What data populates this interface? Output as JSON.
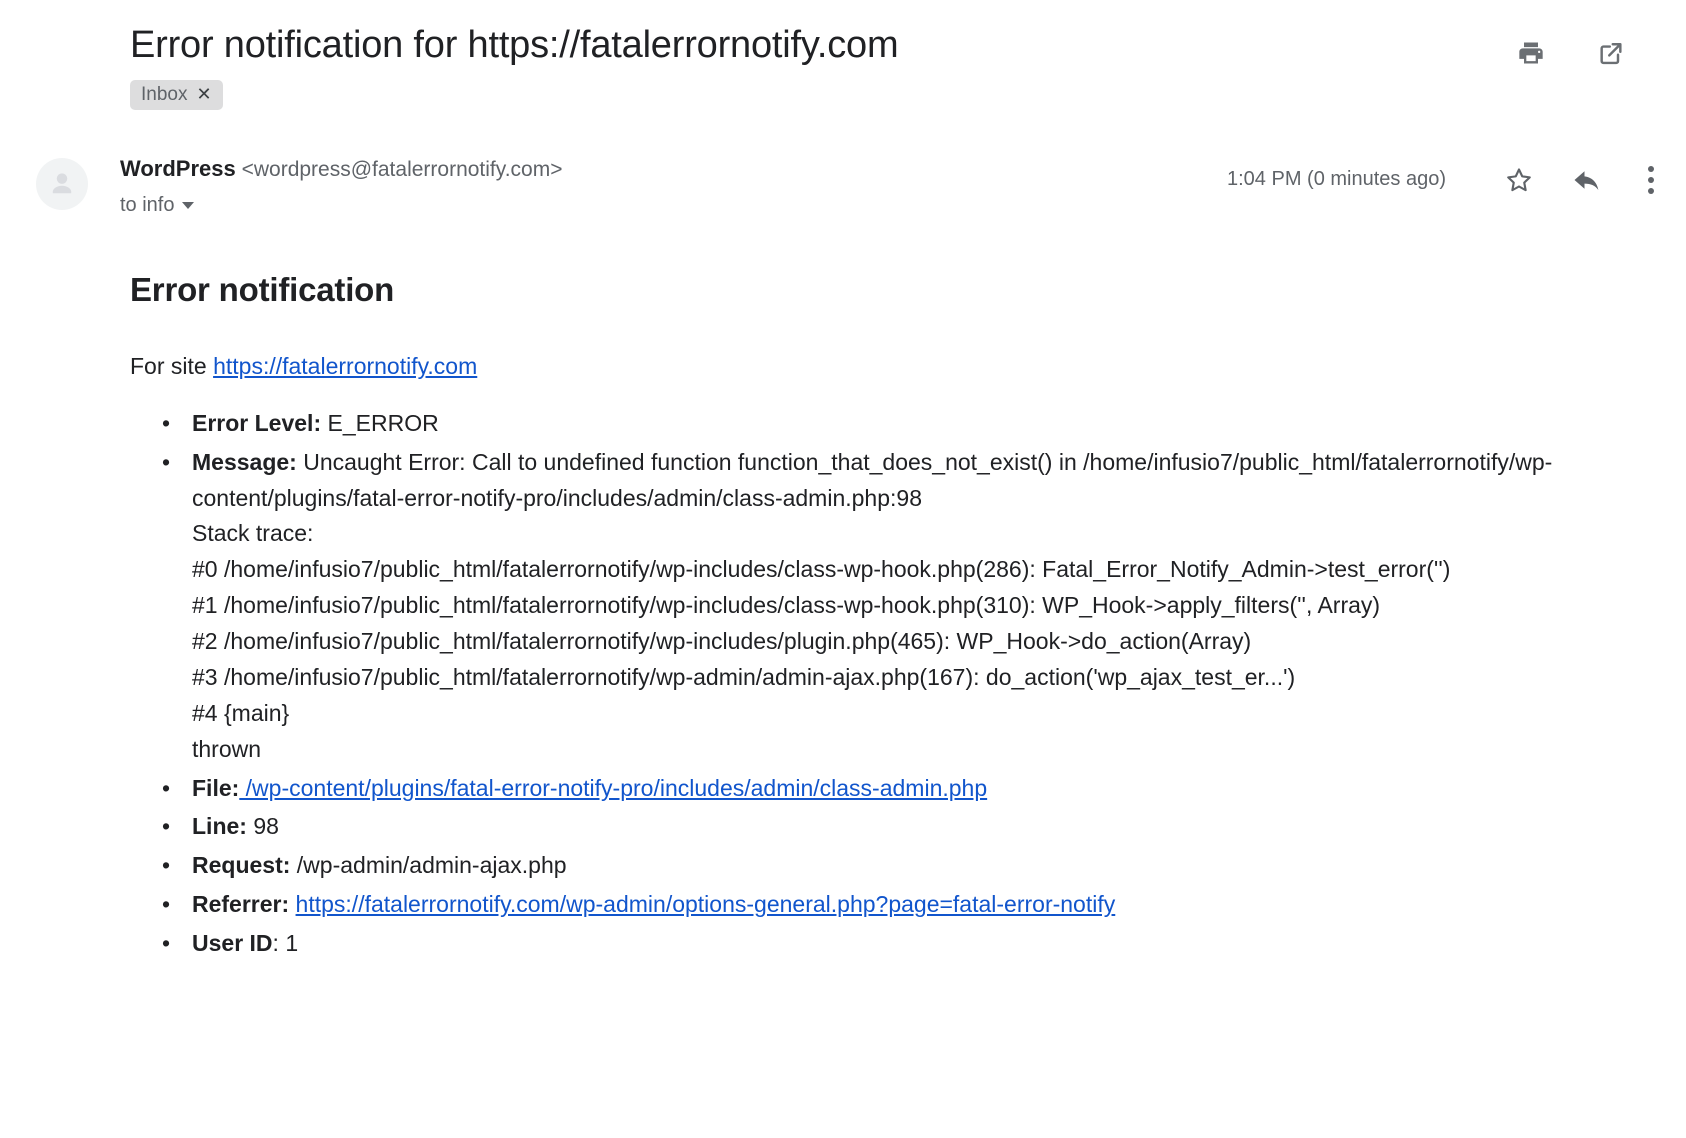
{
  "header": {
    "subject": "Error notification for https://fatalerrornotify.com",
    "label_chip": "Inbox",
    "label_chip_close": "✕",
    "actions": [
      {
        "name": "print-icon",
        "label": "Print"
      },
      {
        "name": "open-in-new-window-icon",
        "label": "Open in new window"
      }
    ]
  },
  "message": {
    "sender_name": "WordPress",
    "sender_email": "<wordpress@fatalerrornotify.com>",
    "recipient": "to info",
    "timestamp": "1:04 PM (0 minutes ago)",
    "actions": [
      {
        "name": "star-icon",
        "label": "Not starred"
      },
      {
        "name": "reply-icon",
        "label": "Reply"
      },
      {
        "name": "more-options-icon",
        "label": "More"
      }
    ]
  },
  "body": {
    "heading": "Error notification",
    "for_site_prefix": "For site ",
    "site_url": "https://fatalerrornotify.com",
    "items": {
      "error_level_label": "Error Level:",
      "error_level_value": " E_ERROR",
      "message_label": "Message:",
      "message_text_1": " Uncaught Error: Call to undefined function function_that_does_not_exist() in /home/infusio7/public_html/fatalerrornotify/wp-content/plugins/fatal-error-notify-pro/includes/admin/class-admin.php:98",
      "message_stack_heading": "Stack trace:",
      "stack_0": "#0 /home/infusio7/public_html/fatalerrornotify/wp-includes/class-wp-hook.php(286): Fatal_Error_Notify_Admin->test_error('')",
      "stack_1": "#1 /home/infusio7/public_html/fatalerrornotify/wp-includes/class-wp-hook.php(310): WP_Hook->apply_filters('', Array)",
      "stack_2": "#2 /home/infusio7/public_html/fatalerrornotify/wp-includes/plugin.php(465): WP_Hook->do_action(Array)",
      "stack_3": "#3 /home/infusio7/public_html/fatalerrornotify/wp-admin/admin-ajax.php(167): do_action('wp_ajax_test_er...')",
      "stack_4": "#4 {main}",
      "stack_thrown": "thrown",
      "file_label": "File:",
      "file_value": " /wp-content/plugins/fatal-error-notify-pro/includes/admin/class-admin.php",
      "line_label": "Line:",
      "line_value": " 98",
      "request_label": "Request:",
      "request_value": " /wp-admin/admin-ajax.php",
      "referrer_label": "Referrer:",
      "referrer_value": "https://fatalerrornotify.com/wp-admin/options-general.php?page=fatal-error-notify",
      "userid_label": "User ID",
      "userid_value": ": 1"
    }
  },
  "colors": {
    "link": "#1155cc",
    "text": "#202124",
    "muted": "#5f6368",
    "chip_bg": "#ddddde",
    "avatar_bg": "#f1f3f4"
  }
}
